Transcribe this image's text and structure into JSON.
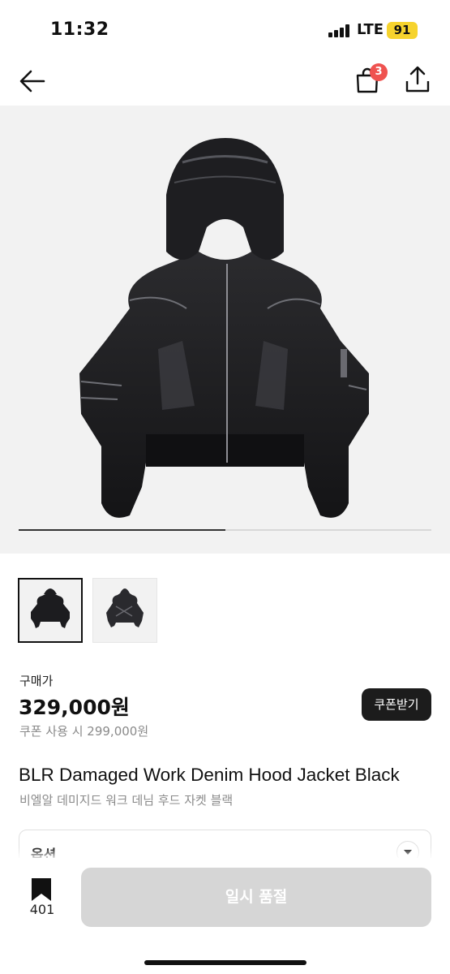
{
  "status_bar": {
    "time": "11:32",
    "network": "LTE",
    "battery": "91",
    "battery_color": "#f6d32d"
  },
  "nav": {
    "back_icon": "arrow-left-icon",
    "cart_icon": "shopping-bag-icon",
    "cart_badge": "3",
    "badge_color": "#ef5350",
    "share_icon": "share-icon"
  },
  "hero": {
    "image_progress": 0.5
  },
  "thumbnails": [
    {
      "name": "jacket-front"
    },
    {
      "name": "jacket-back"
    }
  ],
  "price": {
    "label": "구매가",
    "value": "329,000원",
    "coupon_text": "쿠폰 사용 시 299,000원",
    "coupon_button": "쿠폰받기"
  },
  "product": {
    "name_en": "BLR Damaged Work Denim Hood Jacket Black",
    "name_ko": "비엘알 데미지드 워크 데님 후드 자켓 블랙"
  },
  "options": {
    "label": "옵션"
  },
  "bottom": {
    "bookmark_count": "401",
    "soldout_label": "일시 품절"
  }
}
